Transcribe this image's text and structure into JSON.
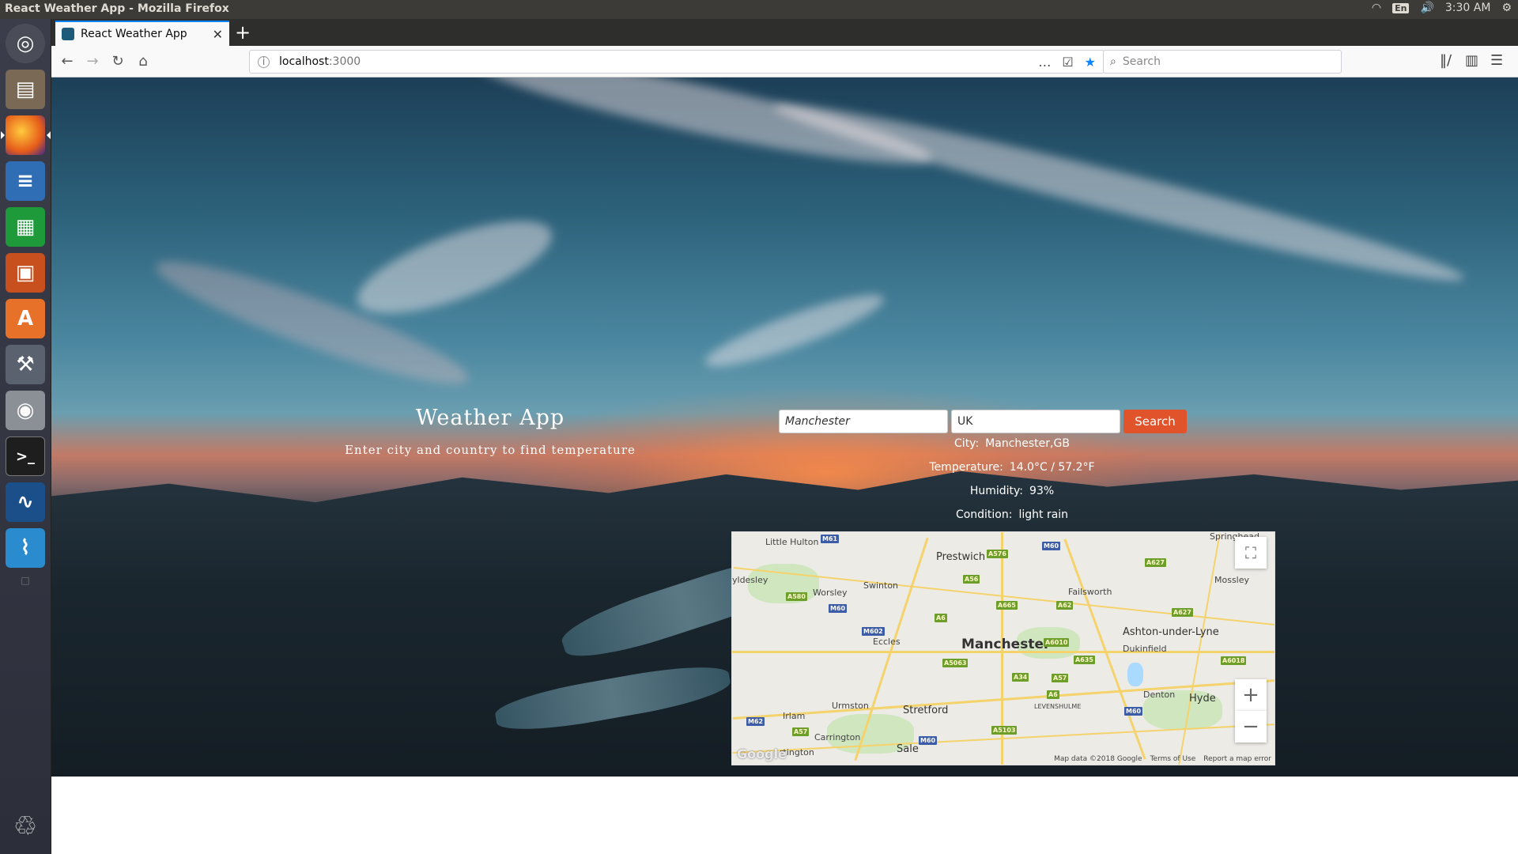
{
  "window": {
    "title": "React Weather App - Mozilla Firefox"
  },
  "tray": {
    "lang": "En",
    "time": "3:30 AM"
  },
  "browser": {
    "tab_title": "React Weather App",
    "url_host": "localhost",
    "url_port": ":3000",
    "search_placeholder": "Search"
  },
  "page": {
    "title": "Weather App",
    "subtitle": "Enter city and country to find temperature",
    "city_value": "Manchester",
    "country_value": "UK",
    "search_label": "Search",
    "results": [
      {
        "label": "City:",
        "value": "Manchester,GB"
      },
      {
        "label": "Temperature:",
        "value": "14.0°C / 57.2°F"
      },
      {
        "label": "Humidity:",
        "value": "93%"
      },
      {
        "label": "Condition:",
        "value": "light rain"
      }
    ]
  },
  "map": {
    "places": {
      "manchester": "Manchester",
      "little_hulton": "Little Hulton",
      "prestwich": "Prestwich",
      "springhead": "Springhead",
      "tyldesley": "yldesley",
      "worsley": "Worsley",
      "swinton": "Swinton",
      "failsworth": "Failsworth",
      "mossley": "Mossley",
      "eccles": "Eccles",
      "ashton": "Ashton-under-Lyne",
      "dukinfield": "Dukinfield",
      "irlam": "Irlam",
      "urmston": "Urmston",
      "stretford": "Stretford",
      "levenshulme": "LEVENSHULME",
      "denton": "Denton",
      "hyde": "Hyde",
      "carrington": "Carrington",
      "sale": "Sale",
      "partington": "rtington"
    },
    "shields": {
      "m61": "M61",
      "a576": "A576",
      "m60a": "M60",
      "a627": "A627",
      "a56": "A56",
      "a580": "A580",
      "m60b": "M60",
      "a665": "A665",
      "a62": "A62",
      "a627b": "A627",
      "a6a": "A6",
      "m602": "M602",
      "a6010": "A6010",
      "a635": "A635",
      "a6018": "A6018",
      "a5063": "A5063",
      "a34": "A34",
      "a57": "A57",
      "a6b": "A6",
      "m62": "M62",
      "a57b": "A57",
      "m60c": "M60",
      "a5103": "A5103",
      "m60d": "M60"
    },
    "footer_data": "Map data ©2018 Google",
    "footer_terms": "Terms of Use",
    "footer_report": "Report a map error",
    "logo": "Google"
  }
}
